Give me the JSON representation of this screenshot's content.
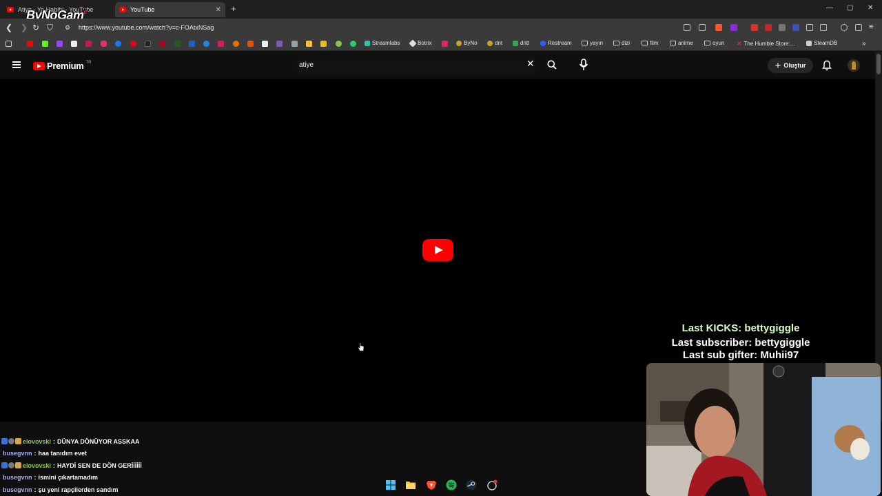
{
  "browser": {
    "tabs": [
      {
        "title": "Atiye - Ya Habibi - YouTube"
      },
      {
        "title": "YouTube"
      }
    ],
    "new_tab": "+",
    "url": "https://www.youtube.com/watch?v=c-FOAtxNSag",
    "stream_logo": "ByNoGam",
    "stream_logo_accent": "e"
  },
  "bookmarks": [
    {
      "label": "Streamlabs"
    },
    {
      "label": "Botrix"
    },
    {
      "label": "ByNo"
    },
    {
      "label": "dnt"
    },
    {
      "label": "dntt"
    },
    {
      "label": "Restream"
    },
    {
      "label": "yayın"
    },
    {
      "label": "dizi"
    },
    {
      "label": "film"
    },
    {
      "label": "anime"
    },
    {
      "label": "oyun"
    },
    {
      "label": "The Humble Store:..."
    },
    {
      "label": "SteamDB"
    }
  ],
  "youtube": {
    "logo_text": "Premium",
    "country_code": "TR",
    "search_value": "atiye",
    "create_label": "Oluştur",
    "accent_color": "#ff0000"
  },
  "overlay": {
    "last_kicks": "Last KICKS: bettygiggle",
    "last_subscriber": "Last subscriber: bettygiggle",
    "last_sub_gifter": "Last sub gifter: Muhii97"
  },
  "chat": [
    {
      "user": "elovovski",
      "message": "DÜNYA DÖNÜYOR ASSKAA",
      "badges": true
    },
    {
      "user": "busegvnn",
      "message": "haa tanıdım evet",
      "badges": false
    },
    {
      "user": "elovovski",
      "message": "HAYDİ SEN DE DÖN GERİİİİİİ",
      "badges": true
    },
    {
      "user": "busegvnn",
      "message": "ismini çıkartamadım",
      "badges": false
    },
    {
      "user": "busegvnn",
      "message": "şu yeni rapçilerden sandım",
      "badges": false
    }
  ],
  "chat_separator": ":"
}
